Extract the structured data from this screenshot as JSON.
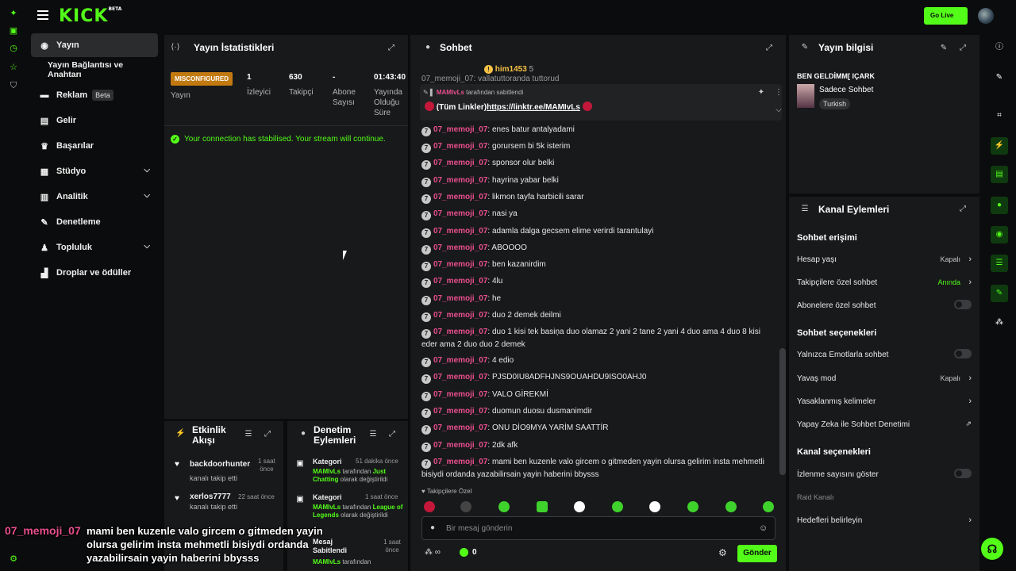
{
  "header": {
    "logo": "KICK",
    "logo_beta": "BETA",
    "go_live_label": "Go Live"
  },
  "sidebar": {
    "items": [
      {
        "label": "Yayın",
        "icon": "broadcast-icon"
      },
      {
        "label": "Yayın Bağlantısı ve Anahtarı"
      },
      {
        "label": "Reklam",
        "badge": "Beta",
        "icon": "ads-icon"
      },
      {
        "label": "Gelir",
        "icon": "wallet-icon"
      },
      {
        "label": "Başarılar",
        "icon": "trophy-icon"
      },
      {
        "label": "Stüdyo",
        "icon": "studio-icon"
      },
      {
        "label": "Analitik",
        "icon": "chart-icon"
      },
      {
        "label": "Denetleme",
        "icon": "wrench-icon"
      },
      {
        "label": "Topluluk",
        "icon": "community-icon"
      },
      {
        "label": "Droplar ve ödüller",
        "icon": "gift-icon"
      }
    ]
  },
  "stats": {
    "title": "Yayın İstatistikleri",
    "status_badge": "MISCONFIGURED",
    "status_label": "Yayın",
    "viewers_value": "1",
    "viewers_label": "İzleyici",
    "followers_value": "630",
    "followers_label": "Takipçi",
    "subs_value": "-",
    "subs_label_1": "Abone",
    "subs_label_2": "Sayısı",
    "duration_value": "01:43:40",
    "duration_label_1": "Yayında",
    "duration_label_2": "Olduğu",
    "duration_label_3": "Süre",
    "notice": "Your connection has stabilised. Your stream will continue."
  },
  "activity": {
    "title_1": "Etkinlik",
    "title_2": "Akışı",
    "items": [
      {
        "name": "backdoorhunter",
        "sub": "kanalı takip etti",
        "time_1": "1 saat",
        "time_2": "önce"
      },
      {
        "name": "xerlos7777",
        "sub": "kanalı takip etti",
        "time_1": "22 saat önce",
        "time_2": ""
      }
    ]
  },
  "modlog": {
    "title_1": "Denetim",
    "title_2": "Eylemleri",
    "items": [
      {
        "head": "Kategori",
        "time": "51 dakika önce",
        "user": "MAMIvLs",
        "mid": " tarafından ",
        "target": "Just Chatting",
        "tail": " olarak değiştirildi"
      },
      {
        "head": "Kategori",
        "time": "1 saat önce",
        "user": "MAMIvLs",
        "mid": " tarafından ",
        "target": "League of Legends",
        "tail": " olarak değiştirildi"
      },
      {
        "head": "Mesaj Sabitlendi",
        "time": "1 saat önce",
        "user": "MAMIvLs",
        "mid": " tarafından",
        "target": "",
        "tail": ""
      }
    ]
  },
  "chat": {
    "title": "Sohbet",
    "top_user": "him1453",
    "top_count": "5",
    "partial_top": "07_memoji_07: vallatuttoranda tuttorud",
    "pinned": {
      "user": "MAMIvLs",
      "by": " tarafından sabitlendi",
      "text_prefix": "(Tüm Linkler)",
      "link": "https://linktr.ee/MAMIvLs"
    },
    "messages": [
      {
        "user": "07_memoji_07",
        "text": "enes batur antalyadami"
      },
      {
        "user": "07_memoji_07",
        "text": "gorursem bi 5k isterim"
      },
      {
        "user": "07_memoji_07",
        "text": "sponsor olur belki"
      },
      {
        "user": "07_memoji_07",
        "text": "hayrina yabar belki"
      },
      {
        "user": "07_memoji_07",
        "text": "likmon tayfa harbicili sarar"
      },
      {
        "user": "07_memoji_07",
        "text": "nasi ya"
      },
      {
        "user": "07_memoji_07",
        "text": "adamla dalga gecsem elime verirdi tarantulayi"
      },
      {
        "user": "07_memoji_07",
        "text": "ABOOOO"
      },
      {
        "user": "07_memoji_07",
        "text": "ben kazanirdim"
      },
      {
        "user": "07_memoji_07",
        "text": "4lu"
      },
      {
        "user": "07_memoji_07",
        "text": "he"
      },
      {
        "user": "07_memoji_07",
        "text": "duo 2 demek deilmi"
      },
      {
        "user": "07_memoji_07",
        "text": "duo 1 kisi tek basiņa duo olamaz 2 yani 2 tane 2 yani 4 duo ama 4 duo 8 kisi eder ama 2 duo duo 2 demek"
      },
      {
        "user": "07_memoji_07",
        "text": "4 edio"
      },
      {
        "user": "07_memoji_07",
        "text": "PJSD0IU8ADFHJNS9OUAHDU9ISO0AHJ0"
      },
      {
        "user": "07_memoji_07",
        "text": "VALO GİREKMİ"
      },
      {
        "user": "07_memoji_07",
        "text": "duomun duosu dusmanimdir"
      },
      {
        "user": "07_memoji_07",
        "text": "ONU DİO9MYA YARİM SAATTİR"
      },
      {
        "user": "07_memoji_07",
        "text": "2dk afk"
      },
      {
        "user": "07_memoji_07",
        "text": "mami ben kuzenle valo gircem o gitmeden yayin olursa gelirim insta mehmetli bisiydi ordanda yazabilirsain yayin haberini bbysss"
      }
    ],
    "followers_only_label": "Takipçilere Özel",
    "input_placeholder": "Bir mesaj gönderin",
    "points": "0",
    "send_label": "Gönder"
  },
  "stream_info": {
    "title": "Yayın bilgisi",
    "stream_title": "BEN GELDİMM[ IÇARK",
    "category": "Sadece Sohbet",
    "language": "Turkish"
  },
  "channel_actions": {
    "title": "Kanal Eylemleri",
    "chat_access": "Sohbet erişimi",
    "account_age": "Hesap yaşı",
    "account_age_val": "Kapalı",
    "followers_chat": "Takipçilere özel sohbet",
    "followers_chat_val": "Anında",
    "subs_chat": "Abonelere özel sohbet",
    "chat_options": "Sohbet seçenekleri",
    "emote_only": "Yalnızca Emotlarla sohbet",
    "slow_mode": "Yavaş mod",
    "slow_mode_val": "Kapalı",
    "banned_words": "Yasaklanmış kelimeler",
    "ai_mod": "Yapay Zeka ile Sohbet Denetimi",
    "channel_options": "Kanal seçenekleri",
    "show_viewers": "İzlenme sayısını göster",
    "raid": "Raid Kanalı",
    "targets": "Hedefleri belirleyin"
  },
  "overlay": {
    "user": "07_memoji_07",
    "text": "mami ben kuzenle valo gircem o gitmeden yayin olursa gelirim insta mehmetli bisiydi ordanda yazabilirsain yayin haberini bbysss"
  },
  "colors": {
    "accent": "#53fc18",
    "username": "#e94f8e",
    "warning": "#c27a10"
  }
}
